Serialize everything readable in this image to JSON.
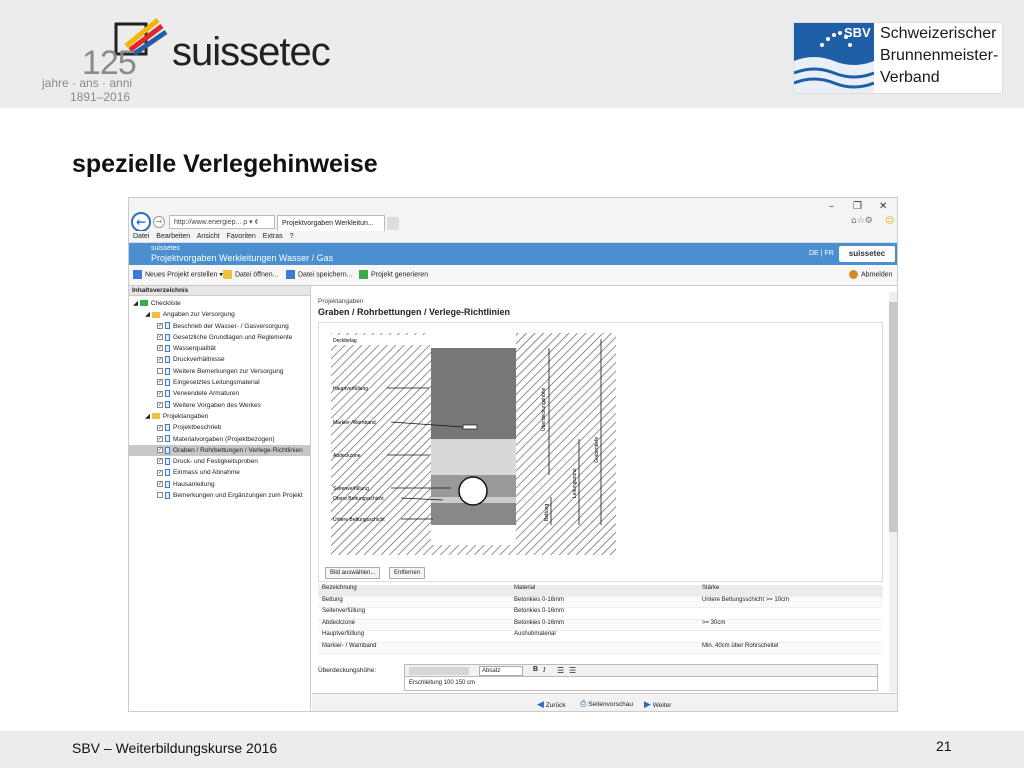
{
  "logo": {
    "number": "125",
    "brand": "suissetec",
    "sub1": "jahre · ans · anni",
    "sub2": "1891–2016"
  },
  "sbv_logo": {
    "abbr": "SBV",
    "line1": "Schweizerischer",
    "line2": "Brunnenmeister-",
    "line3": "Verband"
  },
  "slide": {
    "title": "spezielle Verlegehinweise",
    "footer": "SBV – Weiterbildungskurse 2016",
    "page_number": "21"
  },
  "browser": {
    "url": "http://www.energiep... ρ ▾ ¢",
    "tab_label": "Projektvorgaben Werkleitun...",
    "menu": [
      "Datei",
      "Bearbeiten",
      "Ansicht",
      "Favoriten",
      "Extras",
      "?"
    ]
  },
  "app": {
    "title_small": "suissetec",
    "title": "Projektvorgaben Werkleitungen Wasser / Gas",
    "lang": "DE | FR",
    "logo": "suissetec",
    "toolbar": [
      "Neues Projekt erstellen ▾",
      "Datei öffnen...",
      "Datei speichern...",
      "Projekt generieren"
    ],
    "logout": "Abmelden"
  },
  "sidebar": {
    "heading": "Inhaltsverzeichnis",
    "items": [
      {
        "label": "Checkliste",
        "level": 0,
        "type": "root"
      },
      {
        "label": "Angaben zur Versorgung",
        "level": 1,
        "type": "folder"
      },
      {
        "label": "Beschrieb der Wasser- / Gasversorgung",
        "level": 2,
        "checked": true
      },
      {
        "label": "Gesetzliche Grundlagen und Reglemente",
        "level": 2,
        "checked": true
      },
      {
        "label": "Wasserqualität",
        "level": 2,
        "checked": true
      },
      {
        "label": "Druckverhältnisse",
        "level": 2,
        "checked": true
      },
      {
        "label": "Weitere Bemerkungen zur Versorgung",
        "level": 2,
        "checked": false
      },
      {
        "label": "Eingesetztes Leitungsmaterial",
        "level": 2,
        "checked": true
      },
      {
        "label": "Verwendete Armaturen",
        "level": 2,
        "checked": true
      },
      {
        "label": "Weitere Vorgaben des Werkes",
        "level": 2,
        "checked": true
      },
      {
        "label": "Projektangaben",
        "level": 1,
        "type": "folder"
      },
      {
        "label": "Projektbeschrieb",
        "level": 2,
        "checked": true
      },
      {
        "label": "Materialvorgaben (Projektbezogen)",
        "level": 2,
        "checked": true
      },
      {
        "label": "Graben / Rohrbettungen / Verlege-Richtlinien",
        "level": 2,
        "checked": true,
        "selected": true
      },
      {
        "label": "Druck- und Festigkeitsproben",
        "level": 2,
        "checked": true
      },
      {
        "label": "Einmass und Abnahme",
        "level": 2,
        "checked": true
      },
      {
        "label": "Hausanleitung",
        "level": 2,
        "checked": true
      },
      {
        "label": "Bemerkungen und Ergänzungen zum Projekt",
        "level": 2,
        "checked": false
      }
    ]
  },
  "content": {
    "breadcrumb": "Projektangaben",
    "section_title": "Graben / Rohrbettungen / Verlege-Richtlinien",
    "diagram_labels": {
      "belag": "Deckbelag",
      "haupt": "Hauptverfüllung",
      "marker": "Markier-/Warnband",
      "abdeck": "Abdeckzone",
      "seiten": "Seitenverfüllung",
      "obere": "Obere Bettungsschicht",
      "untere": "Untere Bettungsschicht",
      "ueberdeckung": "Überdeckungshöhe",
      "leitungszone": "Leitungszone",
      "grabentiefe": "Grabentiefe",
      "bettung": "Bettung"
    },
    "buttons": {
      "choose_image": "Bild auswählen...",
      "remove": "Entfernen"
    },
    "table": {
      "headers": [
        "Bezeichnung",
        "Material",
        "Stärke"
      ],
      "rows": [
        [
          "Bettung",
          "Betonkies 0-16mm",
          "Untere Bettungsschicht >= 10cm"
        ],
        [
          "Seitenverfüllung",
          "Betonkies 0-16mm",
          ""
        ],
        [
          "Abdeckzone",
          "Betonkies 0-16mm",
          ">= 30cm"
        ],
        [
          "Hauptverfüllung",
          "Aushubmaterial",
          ""
        ],
        [
          "Markier- / Warnband",
          "",
          "Min. 40cm über Rohrscheitel"
        ]
      ]
    },
    "editor_label": "Überdeckungshöhe:",
    "editor_format": "Absatz",
    "editor_text": "Erschleitung 100 150 cm"
  },
  "footer_nav": {
    "back": "Zurück",
    "preview": "Seitenvorschau",
    "next": "Weiter"
  },
  "colors": {
    "app_blue": "#4a8fcf",
    "band_grey": "#ececec",
    "sbv_blue": "#1f5fa8"
  }
}
